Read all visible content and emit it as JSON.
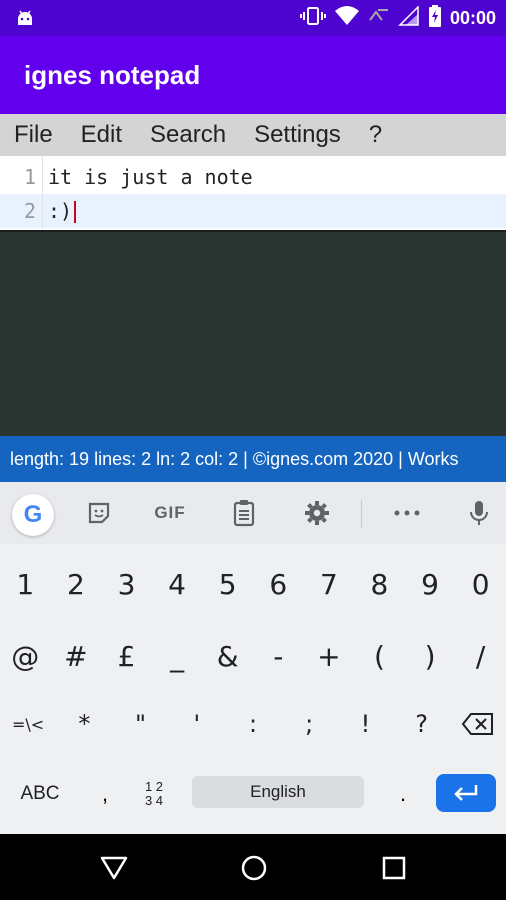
{
  "status_bar": {
    "time": "00:00",
    "icons": [
      "android-icon",
      "vibrate-icon",
      "wifi-icon",
      "data-icon",
      "signal-icon",
      "battery-charging-icon"
    ]
  },
  "app": {
    "title": "ignes notepad"
  },
  "menu": {
    "items": [
      {
        "label": "File"
      },
      {
        "label": "Edit"
      },
      {
        "label": "Search"
      },
      {
        "label": "Settings"
      },
      {
        "label": "?"
      }
    ]
  },
  "editor": {
    "lines": [
      {
        "number": "1",
        "text": "it is just a note"
      },
      {
        "number": "2",
        "text": ":)"
      }
    ],
    "current_line_highlight": "#e8f2ff",
    "caret_color": "#d0021b"
  },
  "status_line": {
    "text": "length: 19 lines: 2 ln: 2 col: 2 | ©ignes.com 2020 | Works"
  },
  "keyboard": {
    "toolbar_icons": [
      "google-icon",
      "sticker-icon",
      "gif-icon",
      "clipboard-icon",
      "settings-icon",
      "more-icon",
      "mic-icon"
    ],
    "gif_label": "GIF",
    "google_label": "G",
    "row1": [
      "1",
      "2",
      "3",
      "4",
      "5",
      "6",
      "7",
      "8",
      "9",
      "0"
    ],
    "row2": [
      "@",
      "#",
      "£",
      "_",
      "&",
      "-",
      "+",
      "(",
      ")",
      "/"
    ],
    "row3": [
      "=\\<",
      "*",
      "\"",
      "'",
      ":",
      ";",
      "!",
      "?"
    ],
    "abc_label": "ABC",
    "comma": ",",
    "fraction_top": "1 2",
    "fraction_bottom": "3 4",
    "space_label": "English",
    "period": "."
  },
  "colors": {
    "status_bar": "#4e05cf",
    "app_bar": "#6200ee",
    "status_line": "#1565c0",
    "enter_key": "#1a73e8"
  }
}
